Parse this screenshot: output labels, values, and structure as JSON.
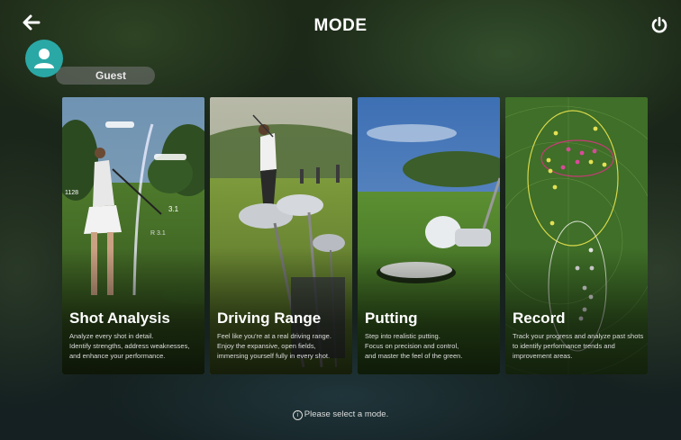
{
  "header": {
    "title": "MODE",
    "back_icon": "back-arrow-icon",
    "power_icon": "power-icon"
  },
  "user": {
    "name": "Guest",
    "avatar_color": "#2aa8a6"
  },
  "modes": [
    {
      "title": "Shot Analysis",
      "desc": [
        "Analyze every shot in detail.",
        "Identify strengths, address weaknesses,",
        "and enhance your performance."
      ],
      "overlay": {
        "carry": "1128",
        "angle": "3.1",
        "spin": "R 3.1"
      }
    },
    {
      "title": "Driving Range",
      "desc": [
        "Feel like you're at a real driving range.",
        "Enjoy the expansive, open fields,",
        "immersing yourself fully in every shot."
      ]
    },
    {
      "title": "Putting",
      "desc": [
        "Step into realistic putting.",
        "Focus on precision and control,",
        "and master the feel of the green."
      ]
    },
    {
      "title": "Record",
      "desc": [
        "Track your progress and analyze past shots",
        "to identify performance trends and",
        "improvement areas."
      ]
    }
  ],
  "footer": {
    "hint": "Please select a mode.",
    "hint_icon": "info-icon"
  }
}
